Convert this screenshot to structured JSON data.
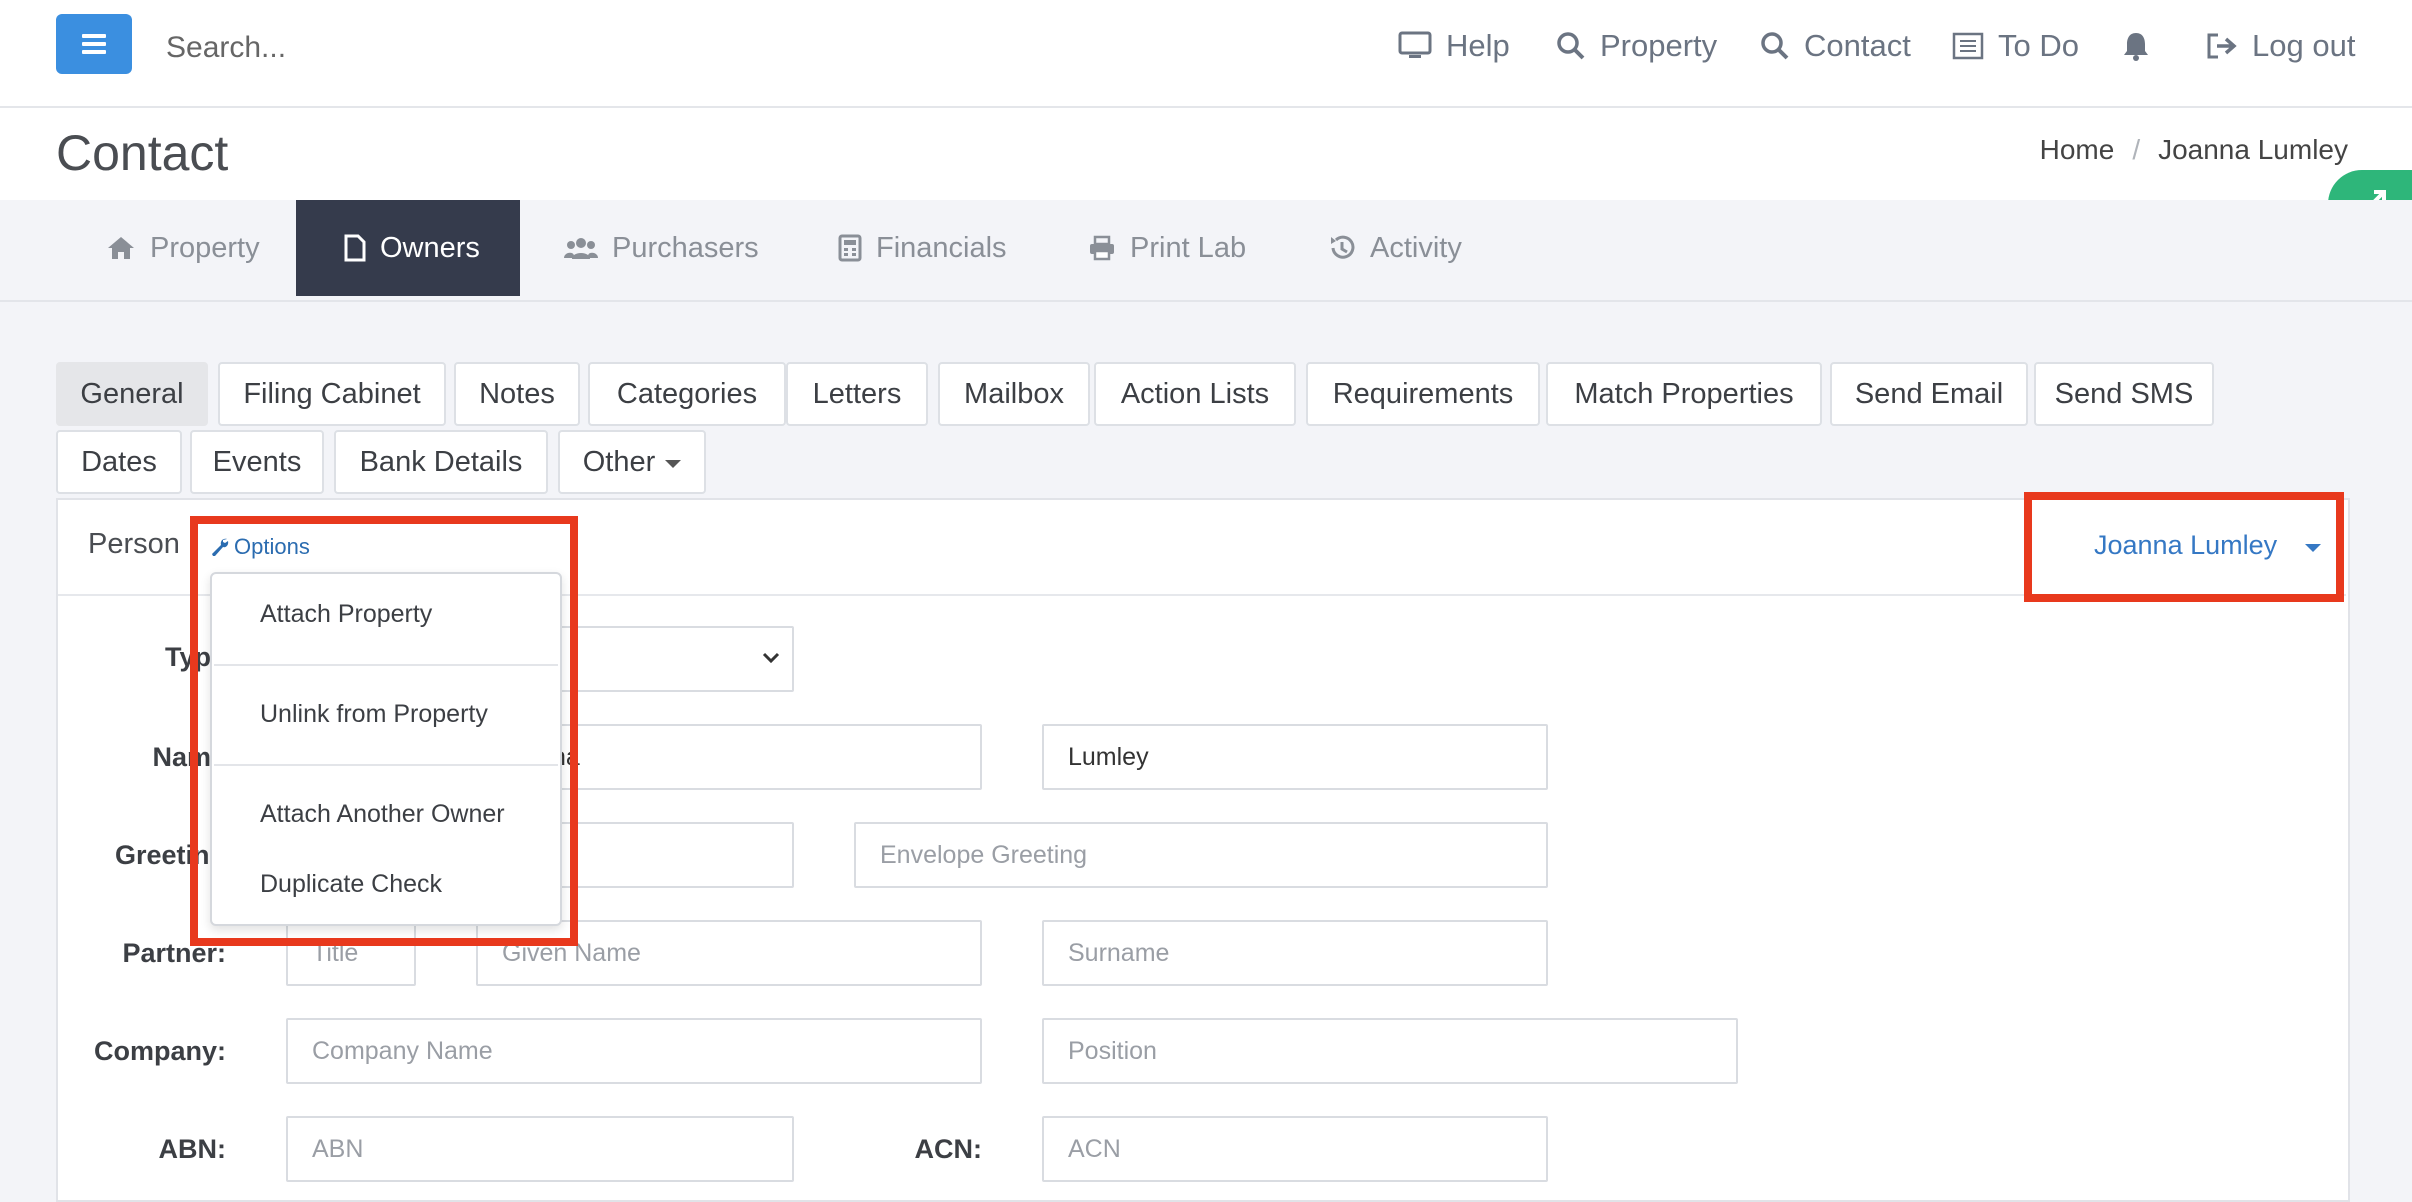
{
  "topbar": {
    "search_placeholder": "Search...",
    "nav": [
      {
        "label": "Help",
        "icon": "monitor-icon"
      },
      {
        "label": "Property",
        "icon": "search-icon"
      },
      {
        "label": "Contact",
        "icon": "search-icon"
      },
      {
        "label": "To Do",
        "icon": "list-icon"
      },
      {
        "label": "",
        "icon": "bell-icon"
      },
      {
        "label": "Log out",
        "icon": "logout-icon"
      }
    ]
  },
  "header": {
    "title": "Contact",
    "breadcrumb": [
      "Home",
      "Joanna Lumley"
    ]
  },
  "module_tabs": [
    {
      "label": "Property",
      "icon": "home-icon"
    },
    {
      "label": "Owners",
      "icon": "file-icon",
      "active": true
    },
    {
      "label": "Purchasers",
      "icon": "users-icon"
    },
    {
      "label": "Financials",
      "icon": "calculator-icon"
    },
    {
      "label": "Print Lab",
      "icon": "printer-icon"
    },
    {
      "label": "Activity",
      "icon": "history-icon"
    }
  ],
  "sub_tabs": {
    "row1": [
      "General",
      "Filing Cabinet",
      "Notes",
      "Categories",
      "Letters",
      "Mailbox",
      "Action Lists",
      "Requirements",
      "Match Properties",
      "Send Email",
      "Send SMS"
    ],
    "row2": [
      "Dates",
      "Events",
      "Bank Details",
      "Other"
    ],
    "active": "General"
  },
  "panel": {
    "title": "Person",
    "options_label": "Options",
    "owner_select": "Joanna Lumley",
    "dropdown_items": [
      "Attach Property",
      "Unlink from Property",
      "Attach Another Owner",
      "Duplicate Check"
    ]
  },
  "form": {
    "labels": {
      "type": "Type",
      "name": "Name",
      "greeting": "Greeting",
      "partner": "Partner:",
      "company": "Company:",
      "abn": "ABN:",
      "acn": "ACN:"
    },
    "name_given_partial": "na",
    "surname_value": "Lumley",
    "placeholders": {
      "envelope_greeting": "Envelope Greeting",
      "partner_title": "Title",
      "partner_given": "Given Name",
      "partner_surname": "Surname",
      "company_name": "Company Name",
      "position": "Position",
      "abn": "ABN",
      "acn": "ACN"
    }
  },
  "colors": {
    "accent_blue": "#3b8fe0",
    "active_tab": "#353b4c",
    "highlight_red": "#e8391d",
    "expand_green": "#2eb67a"
  }
}
